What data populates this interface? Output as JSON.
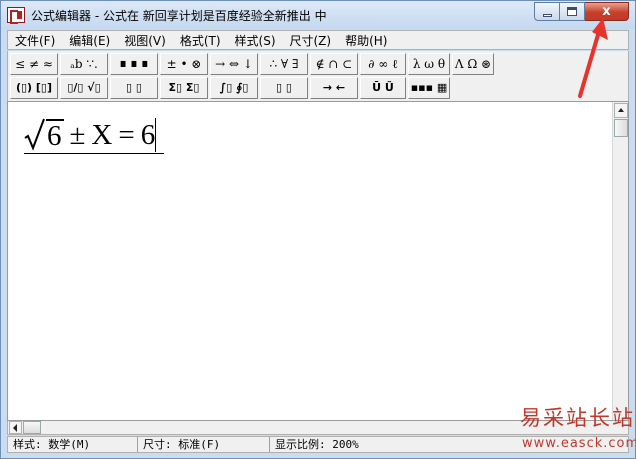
{
  "window": {
    "title": "公式编辑器 - 公式在 新回享计划是百度经验全新推出 中",
    "min_glyph": "",
    "max_glyph": "",
    "close_glyph": "x"
  },
  "menu": [
    "文件(F)",
    "编辑(E)",
    "视图(V)",
    "格式(T)",
    "样式(S)",
    "尺寸(Z)",
    "帮助(H)"
  ],
  "toolbar": {
    "row1": [
      "≤ ≠ ≈",
      "ₐb ∵.",
      "∎ ∎ ∎",
      "± • ⊗",
      "→ ⇔ ↓",
      "∴ ∀ ∃",
      "∉ ∩ ⊂",
      "∂ ∞ ℓ",
      "λ ω θ",
      "Λ Ω ⊛"
    ],
    "row2": [
      "(▯) [▯]",
      "▯/▯ √▯",
      "▯ ▯",
      "Σ▯ Σ▯",
      "∫▯ ∮▯",
      "▯ ▯",
      "→ ←",
      "Ū Ũ",
      "▪▪▪ ▦"
    ]
  },
  "equation": {
    "radicand": "6",
    "rest": [
      "±",
      "X",
      "=",
      "6"
    ]
  },
  "status": {
    "style": "样式: 数学(M)",
    "size": "尺寸: 标准(F)",
    "zoom": "显示比例: 200%"
  },
  "watermark": {
    "name": "易采站长站",
    "url": "www.easck.com"
  },
  "colors": {
    "annotation_arrow": "#e8322a",
    "watermark": "#c0392b",
    "close_button": "#c8402a"
  },
  "icons": {
    "app": "equation-editor-icon",
    "minimize": "minimize-icon",
    "maximize": "maximize-icon",
    "close": "close-icon"
  }
}
